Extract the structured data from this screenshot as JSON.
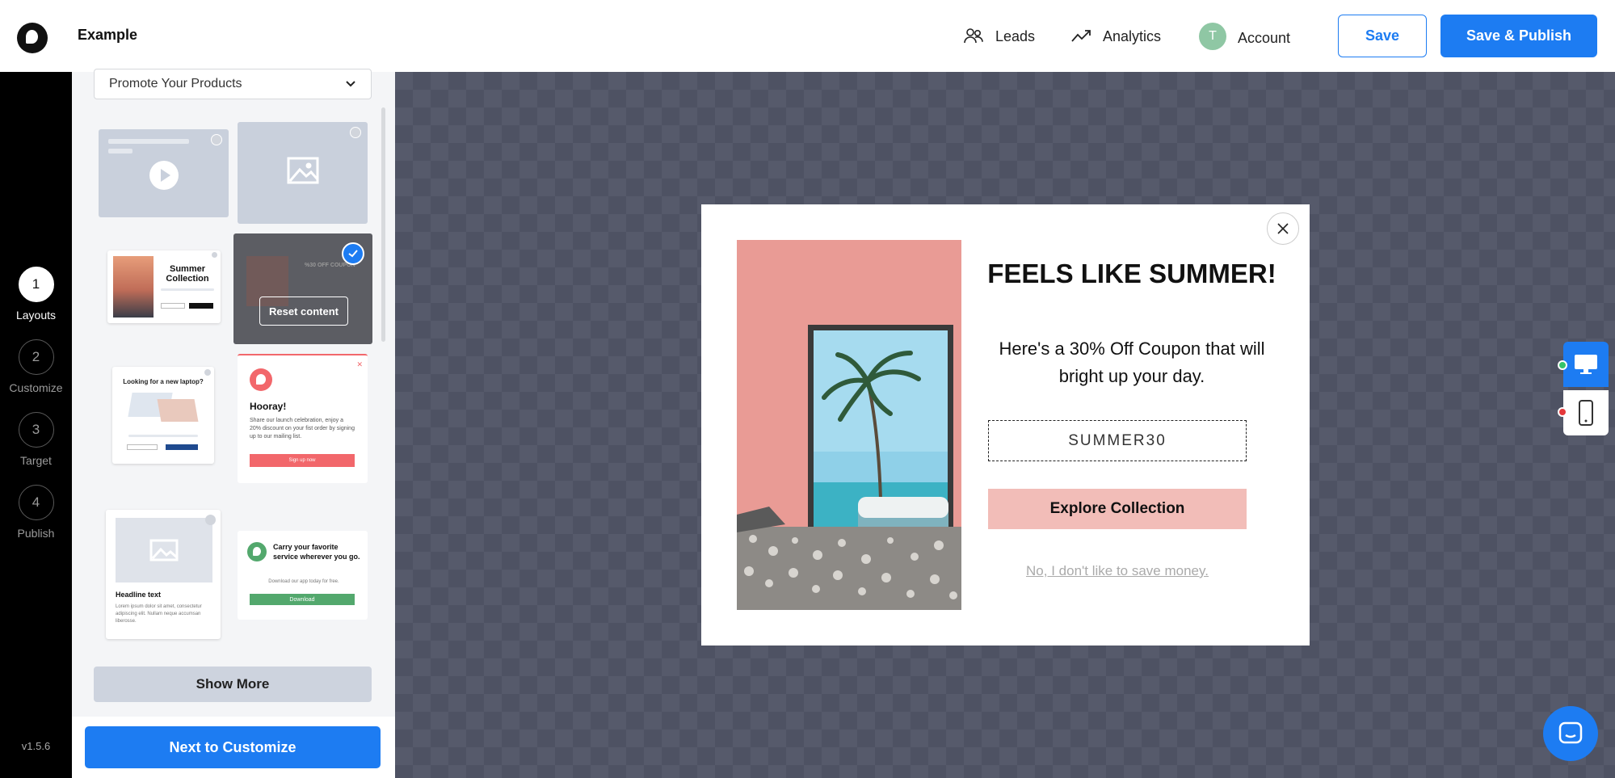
{
  "app": {
    "title": "Example"
  },
  "nav": {
    "leads": "Leads",
    "analytics": "Analytics",
    "account": "Account",
    "avatar_initial": "T",
    "save": "Save",
    "save_publish": "Save & Publish"
  },
  "steps": [
    {
      "num": "1",
      "label": "Layouts"
    },
    {
      "num": "2",
      "label": "Customize"
    },
    {
      "num": "3",
      "label": "Target"
    },
    {
      "num": "4",
      "label": "Publish"
    }
  ],
  "version": "v1.5.6",
  "panel": {
    "category": "Promote Your Products",
    "reset_label": "Reset content",
    "show_more": "Show More",
    "next": "Next to Customize",
    "templates": {
      "summer_title": "Summer Collection",
      "laptop_title": "Looking for a new laptop?",
      "hooray_title": "Hooray!",
      "hooray_body": "Share our launch celebration, enjoy a 20% discount on your fist order by signing up to our mailing list.",
      "hooray_btn": "Sign up now",
      "headline_title": "Headline text",
      "headline_body": "Lorem ipsum dolor sit amet, consectetur adipiscing elit. Nullam neque accumsan liberosse.",
      "carry_title": "Carry your favorite service wherever you go.",
      "carry_body": "Download our app today for free.",
      "carry_btn": "Download",
      "coupon_mini": "%30 OFF COUPON"
    }
  },
  "popup": {
    "headline": "FEELS LIKE SUMMER!",
    "subline": "Here's a 30% Off Coupon that will bright up your day.",
    "coupon_code": "SUMMER30",
    "cta": "Explore Collection",
    "decline": "No, I don't like to save money."
  },
  "colors": {
    "accent": "#1d7cf2",
    "cta_bg": "#f2bdb8",
    "canvas_bg": "#565a6b"
  }
}
